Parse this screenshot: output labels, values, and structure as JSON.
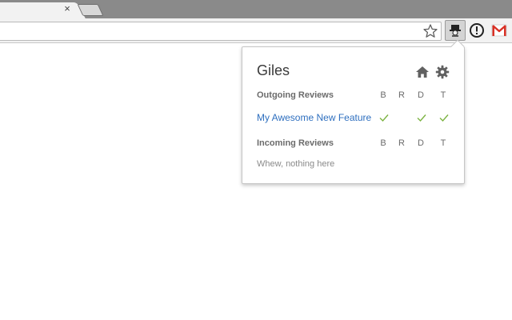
{
  "browser": {
    "tab_close_glyph": "×",
    "icons": [
      "close-icon",
      "star-icon",
      "extension-icon",
      "info-icon",
      "gmail-icon"
    ]
  },
  "popup": {
    "title": "Giles",
    "icons": [
      "home-icon",
      "gear-icon"
    ],
    "outgoing": {
      "header": "Outgoing Reviews",
      "columns": [
        "B",
        "R",
        "D",
        "T"
      ],
      "reviews": [
        {
          "title": "My Awesome New Feature",
          "status": {
            "B": true,
            "R": false,
            "D": true,
            "T": true
          }
        }
      ]
    },
    "incoming": {
      "header": "Incoming Reviews",
      "columns": [
        "B",
        "R",
        "D",
        "T"
      ],
      "empty_message": "Whew, nothing here"
    }
  },
  "colors": {
    "link": "#2e6fbf",
    "check": "#7cb342",
    "tabstrip": "#8a8a8a",
    "toolbar": "#f2f2f2"
  }
}
